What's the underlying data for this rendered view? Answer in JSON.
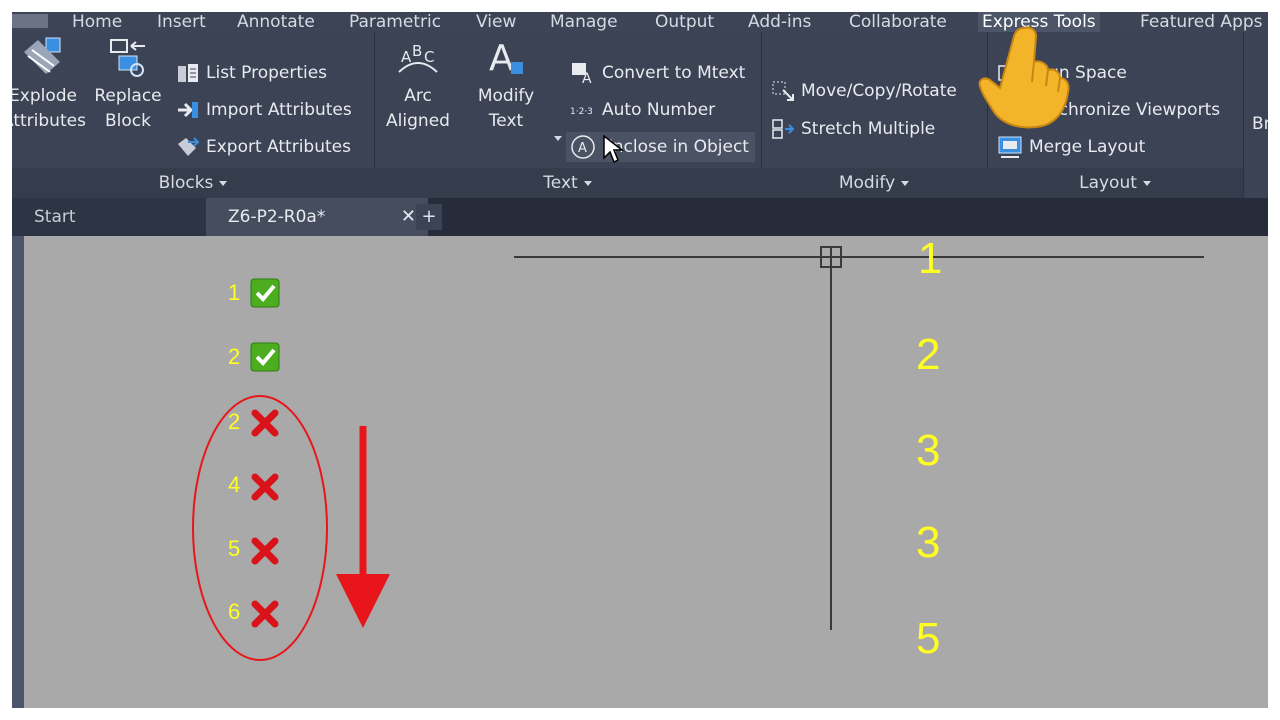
{
  "menubar": {
    "tabs": [
      "Home",
      "Insert",
      "Annotate",
      "Parametric",
      "View",
      "Manage",
      "Output",
      "Add-ins",
      "Collaborate",
      "Express Tools",
      "Featured Apps"
    ],
    "active": "Express Tools"
  },
  "ribbon": {
    "blocks": {
      "label": "Blocks",
      "explode_l1": "Explode",
      "explode_l2": "Attributes",
      "replace_l1": "Replace",
      "replace_l2": "Block",
      "list_properties": "List Properties",
      "import_attributes": "Import Attributes",
      "export_attributes": "Export Attributes"
    },
    "text": {
      "label": "Text",
      "arc_l1": "Arc",
      "arc_l2": "Aligned",
      "modify_l1": "Modify",
      "modify_l2": "Text",
      "convert": "Convert to Mtext",
      "auto_number": "Auto Number",
      "enclose": "Enclose in Object"
    },
    "modify": {
      "label": "Modify",
      "move_copy_rotate": "Move/Copy/Rotate",
      "stretch_multiple": "Stretch Multiple"
    },
    "layout": {
      "label": "Layout",
      "align_space": "Align Space",
      "synchronize": "Synchronize Viewports",
      "merge_layout": "Merge Layout"
    },
    "cutoff_right": "Br"
  },
  "tabs": {
    "start": "Start",
    "active": "Z6-P2-R0a*",
    "close": "✕",
    "add": "+"
  },
  "canvas": {
    "left_list": [
      {
        "num": "1",
        "status": "check"
      },
      {
        "num": "2",
        "status": "check"
      },
      {
        "num": "2",
        "status": "cross"
      },
      {
        "num": "4",
        "status": "cross"
      },
      {
        "num": "5",
        "status": "cross"
      },
      {
        "num": "6",
        "status": "cross"
      }
    ],
    "right_numbers": [
      "1",
      "2",
      "3",
      "3",
      "5"
    ],
    "colors": {
      "number": "#ffff22",
      "annotation": "#e8161b",
      "check": "#4cae1f",
      "cross": "#d8141a"
    }
  }
}
